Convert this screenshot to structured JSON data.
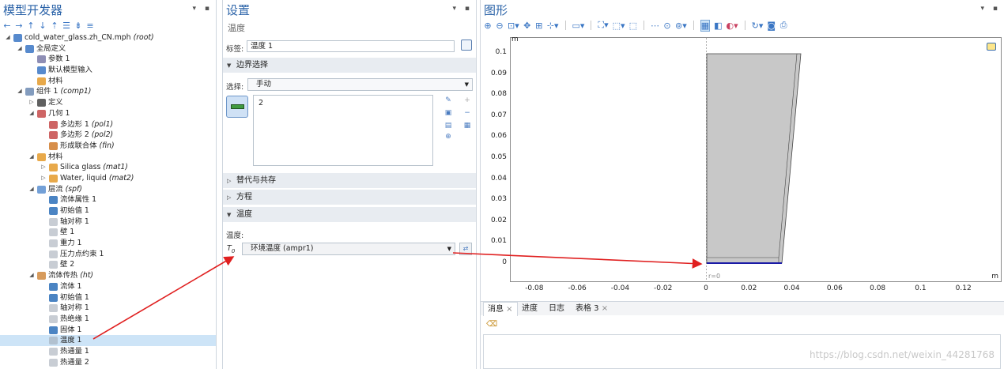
{
  "left": {
    "title": "模型开发器",
    "pins": "▾ ▪",
    "toolbar": [
      "←",
      "→",
      "↑",
      "↓",
      "⇡",
      "☰",
      "⇟",
      "≡"
    ],
    "tree": [
      {
        "depth": 0,
        "toggle": "◢",
        "icon": "root",
        "label": "cold_water_glass.zh_CN.mph",
        "tag": "(root)"
      },
      {
        "depth": 1,
        "toggle": "◢",
        "icon": "globe",
        "label": "全局定义",
        "tag": ""
      },
      {
        "depth": 2,
        "toggle": "",
        "icon": "param",
        "label": "参数 1",
        "tag": ""
      },
      {
        "depth": 2,
        "toggle": "",
        "icon": "default",
        "label": "默认模型输入",
        "tag": ""
      },
      {
        "depth": 2,
        "toggle": "",
        "icon": "material",
        "label": "材料",
        "tag": ""
      },
      {
        "depth": 1,
        "toggle": "◢",
        "icon": "comp",
        "label": "组件 1",
        "tag": "(comp1)"
      },
      {
        "depth": 2,
        "toggle": "▷",
        "icon": "def",
        "label": "定义",
        "tag": ""
      },
      {
        "depth": 2,
        "toggle": "◢",
        "icon": "geom",
        "label": "几何 1",
        "tag": ""
      },
      {
        "depth": 3,
        "toggle": "",
        "icon": "poly",
        "label": "多边形 1",
        "tag": "(pol1)"
      },
      {
        "depth": 3,
        "toggle": "",
        "icon": "poly",
        "label": "多边形 2",
        "tag": "(pol2)"
      },
      {
        "depth": 3,
        "toggle": "",
        "icon": "union",
        "label": "形成联合体",
        "tag": "(fin)"
      },
      {
        "depth": 2,
        "toggle": "◢",
        "icon": "material",
        "label": "材料",
        "tag": ""
      },
      {
        "depth": 3,
        "toggle": "▷",
        "icon": "material",
        "label": "Silica glass",
        "tag": "(mat1)"
      },
      {
        "depth": 3,
        "toggle": "▷",
        "icon": "material",
        "label": "Water, liquid",
        "tag": "(mat2)"
      },
      {
        "depth": 2,
        "toggle": "◢",
        "icon": "laminar",
        "label": "层流",
        "tag": "(spf)"
      },
      {
        "depth": 3,
        "toggle": "",
        "icon": "fluid",
        "label": "流体属性 1",
        "tag": ""
      },
      {
        "depth": 3,
        "toggle": "",
        "icon": "fluid",
        "label": "初始值 1",
        "tag": ""
      },
      {
        "depth": 3,
        "toggle": "",
        "icon": "bnd",
        "label": "轴对称 1",
        "tag": ""
      },
      {
        "depth": 3,
        "toggle": "",
        "icon": "bnd",
        "label": "壁 1",
        "tag": ""
      },
      {
        "depth": 3,
        "toggle": "",
        "icon": "bnd",
        "label": "重力 1",
        "tag": ""
      },
      {
        "depth": 3,
        "toggle": "",
        "icon": "bnd",
        "label": "压力点约束 1",
        "tag": ""
      },
      {
        "depth": 3,
        "toggle": "",
        "icon": "bnd",
        "label": "壁 2",
        "tag": ""
      },
      {
        "depth": 2,
        "toggle": "◢",
        "icon": "heat",
        "label": "流体传热",
        "tag": "(ht)"
      },
      {
        "depth": 3,
        "toggle": "",
        "icon": "fluid",
        "label": "流体 1",
        "tag": ""
      },
      {
        "depth": 3,
        "toggle": "",
        "icon": "fluid",
        "label": "初始值 1",
        "tag": ""
      },
      {
        "depth": 3,
        "toggle": "",
        "icon": "bnd",
        "label": "轴对称 1",
        "tag": ""
      },
      {
        "depth": 3,
        "toggle": "",
        "icon": "bnd",
        "label": "热绝缘 1",
        "tag": ""
      },
      {
        "depth": 3,
        "toggle": "",
        "icon": "solid",
        "label": "固体 1",
        "tag": ""
      },
      {
        "depth": 3,
        "toggle": "",
        "icon": "bnd",
        "label": "温度 1",
        "tag": "",
        "selected": true
      },
      {
        "depth": 3,
        "toggle": "",
        "icon": "bnd",
        "label": "热通量 1",
        "tag": ""
      },
      {
        "depth": 3,
        "toggle": "",
        "icon": "bnd",
        "label": "热通量 2",
        "tag": ""
      }
    ]
  },
  "mid": {
    "title": "设置",
    "subtitle": "温度",
    "label_caption": "标签:",
    "label_value": "温度 1",
    "sections": {
      "boundary": "边界选择",
      "override": "替代与共存",
      "equation": "方程",
      "temperature": "温度"
    },
    "selection_caption": "选择:",
    "selection_value": "手动",
    "boundary_list": [
      "2"
    ],
    "temp_caption": "温度:",
    "t0_symbol": "T",
    "t0_sub": "0",
    "t0_value": "环境温度 (ampr1)"
  },
  "right": {
    "title": "图形",
    "plot": {
      "unit_y": "m",
      "unit_x": "m",
      "r0_label": "r=0",
      "x_ticks": [
        "-0.08",
        "-0.06",
        "-0.04",
        "-0.02",
        "0",
        "0.02",
        "0.04",
        "0.06",
        "0.08",
        "0.1",
        "0.12"
      ],
      "y_ticks": [
        "0",
        "0.01",
        "0.02",
        "0.03",
        "0.04",
        "0.05",
        "0.06",
        "0.07",
        "0.08",
        "0.09",
        "0.1"
      ]
    },
    "tabs": [
      {
        "label": "消息",
        "closable": true,
        "active": true
      },
      {
        "label": "进度",
        "closable": false,
        "active": false
      },
      {
        "label": "日志",
        "closable": false,
        "active": false
      },
      {
        "label": "表格 3",
        "closable": true,
        "active": false
      }
    ],
    "watermark": "https://blog.csdn.net/weixin_44281768"
  },
  "colors": {
    "title_blue": "#2b63a8",
    "selection_blue": "#cde4f7",
    "glass_gray": "#c8c8c8",
    "boundary_blue": "#1a1aa6",
    "arrow_red": "#e02020"
  }
}
